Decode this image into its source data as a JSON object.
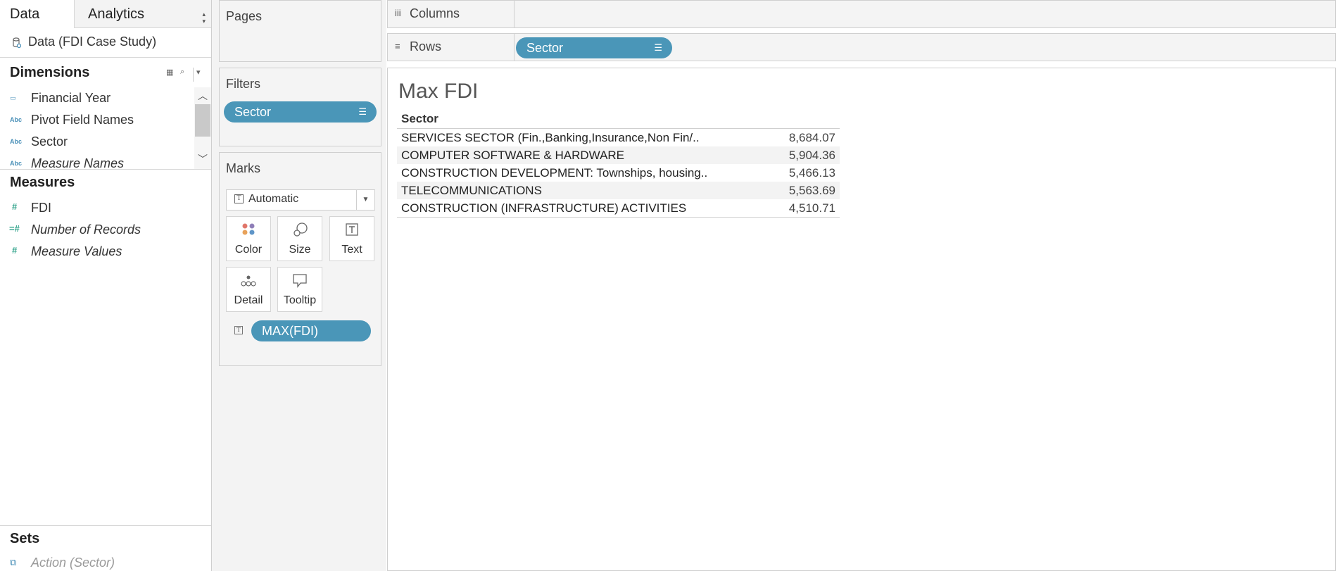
{
  "tabs": {
    "data": "Data",
    "analytics": "Analytics"
  },
  "datasource": "Data (FDI Case Study)",
  "dimensions": {
    "title": "Dimensions",
    "items": [
      {
        "icon": "date-icon",
        "label": "Financial Year"
      },
      {
        "icon": "Abc",
        "label": "Pivot Field Names"
      },
      {
        "icon": "Abc",
        "label": "Sector"
      },
      {
        "icon": "Abc",
        "label": "Measure Names"
      }
    ]
  },
  "measures": {
    "title": "Measures",
    "items": [
      {
        "icon": "#",
        "label": "FDI"
      },
      {
        "icon": "=#",
        "label": "Number of Records"
      },
      {
        "icon": "#",
        "label": "Measure Values"
      }
    ]
  },
  "sets": {
    "title": "Sets",
    "item": "Action (Sector)"
  },
  "pages": {
    "title": "Pages"
  },
  "filters": {
    "title": "Filters",
    "pill": "Sector"
  },
  "marks": {
    "title": "Marks",
    "type": "Automatic",
    "buttons": {
      "color": "Color",
      "size": "Size",
      "text": "Text",
      "detail": "Detail",
      "tooltip": "Tooltip"
    },
    "field": "MAX(FDI)"
  },
  "shelves": {
    "columns": {
      "label": "Columns",
      "icon": "iii"
    },
    "rows": {
      "label": "Rows",
      "icon": "≡",
      "pill": "Sector"
    }
  },
  "viz": {
    "title": "Max FDI",
    "column_header": "Sector",
    "rows": [
      {
        "sector": "SERVICES SECTOR (Fin.,Banking,Insurance,Non Fin/..",
        "value": "8,684.07"
      },
      {
        "sector": "COMPUTER SOFTWARE & HARDWARE",
        "value": "5,904.36"
      },
      {
        "sector": "CONSTRUCTION DEVELOPMENT: Townships, housing..",
        "value": "5,466.13"
      },
      {
        "sector": "TELECOMMUNICATIONS",
        "value": "5,563.69"
      },
      {
        "sector": "CONSTRUCTION (INFRASTRUCTURE) ACTIVITIES",
        "value": "4,510.71"
      }
    ]
  },
  "colors": {
    "pill": "#4a96b8",
    "dimension_icon": "#4a90b8",
    "measure_icon": "#33a48c"
  }
}
